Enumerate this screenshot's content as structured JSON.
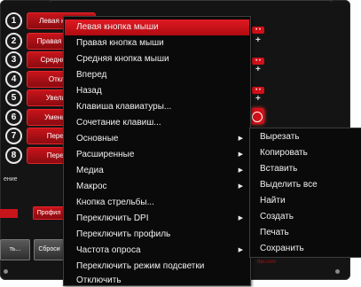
{
  "side_buttons": [
    {
      "num": "1",
      "label": "Левая кнопка"
    },
    {
      "num": "2",
      "label": "Правая кнопка"
    },
    {
      "num": "3",
      "label": "Средняя кно"
    },
    {
      "num": "4",
      "label": "Отключ"
    },
    {
      "num": "5",
      "label": "Увеличит"
    },
    {
      "num": "6",
      "label": "Уменьшит"
    },
    {
      "num": "7",
      "label": "Перемот"
    },
    {
      "num": "8",
      "label": "Перемот"
    }
  ],
  "lower": {
    "left_text": "ение",
    "profile_label": "Профил",
    "ok_label": "ть...",
    "reset_label": "Сброси"
  },
  "brand_text": "tter.com",
  "context_menu": [
    {
      "label": "Левая кнопка мыши",
      "has_submenu": false,
      "active": true
    },
    {
      "label": "Правая кнопка мыши",
      "has_submenu": false
    },
    {
      "label": "Средняя кнопка мыши",
      "has_submenu": false
    },
    {
      "label": "Вперед",
      "has_submenu": false
    },
    {
      "label": "Назад",
      "has_submenu": false
    },
    {
      "label": "Клавиша клавиатуры...",
      "has_submenu": false
    },
    {
      "label": "Сочетание клавиш...",
      "has_submenu": false
    },
    {
      "label": "Основные",
      "has_submenu": true
    },
    {
      "label": "Расширенные",
      "has_submenu": true
    },
    {
      "label": "Медиа",
      "has_submenu": true
    },
    {
      "label": "Макрос",
      "has_submenu": true
    },
    {
      "label": "Кнопка стрельбы...",
      "has_submenu": false
    },
    {
      "label": "Переключить DPI",
      "has_submenu": true
    },
    {
      "label": "Переключить профиль",
      "has_submenu": false
    },
    {
      "label": "Частота опроса",
      "has_submenu": true
    },
    {
      "label": "Переключить режим подсветки",
      "has_submenu": false
    },
    {
      "label": "Отключить",
      "has_submenu": false
    }
  ],
  "submenu": [
    {
      "label": "Вырезать"
    },
    {
      "label": "Копировать"
    },
    {
      "label": "Вставить"
    },
    {
      "label": "Выделить все"
    },
    {
      "label": "Найти"
    },
    {
      "label": "Создать"
    },
    {
      "label": "Печать"
    },
    {
      "label": "Сохранить"
    }
  ],
  "colors": {
    "accent": "#d01018",
    "menu_bg": "#0a0a0a"
  }
}
